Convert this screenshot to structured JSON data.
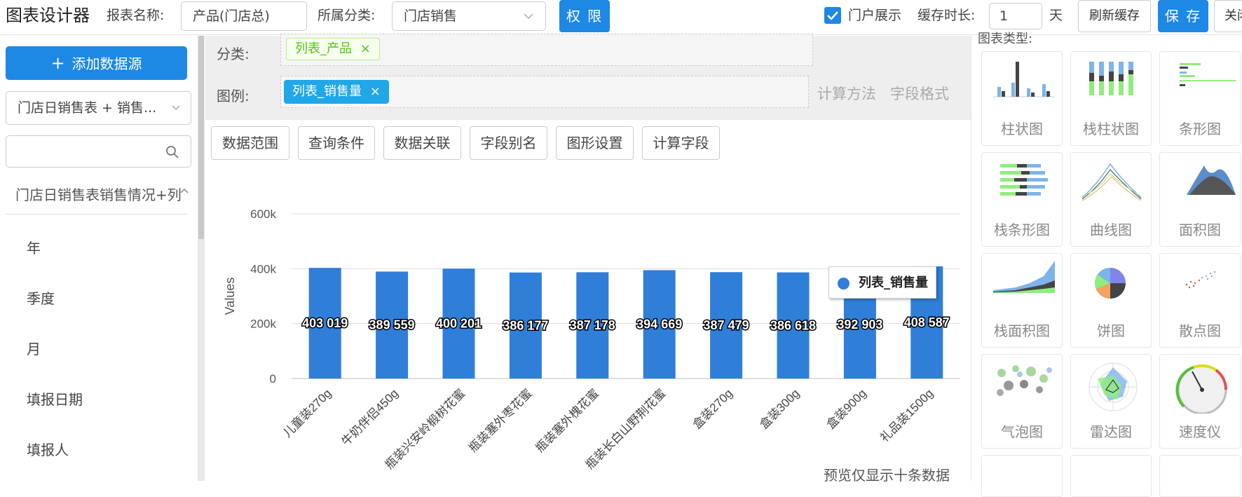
{
  "header": {
    "app_title": "图表设计器",
    "report_name_label": "报表名称:",
    "report_name_value": "产品(门店总)",
    "category_label": "所属分类:",
    "category_value": "门店销售",
    "permission_button": "权 限",
    "portal_display_label": "门户展示",
    "cache_label": "缓存时长:",
    "cache_value": "1",
    "cache_unit": "天",
    "refresh_cache_button": "刷新缓存",
    "save_button": "保 存",
    "close_button": "关闭"
  },
  "sidebar": {
    "add_source_button": "添加数据源",
    "source_select": "门店日销售表 + 销售...",
    "table_name": "门店日销售表销售情况+列",
    "fields": [
      "年",
      "季度",
      "月",
      "填报日期",
      "填报人"
    ]
  },
  "config": {
    "category_label": "分类:",
    "category_tag": "列表_产品",
    "legend_label": "图例:",
    "legend_tag": "列表_销售量",
    "calc_method": "计算方法",
    "field_format": "字段格式",
    "tabs": [
      "数据范围",
      "查询条件",
      "数据关联",
      "字段别名",
      "图形设置",
      "计算字段"
    ]
  },
  "chart_data": {
    "type": "bar",
    "categories": [
      "儿童装270g",
      "牛奶伴侣450g",
      "瓶装兴安岭椴树花蜜",
      "瓶装塞外枣花蜜",
      "瓶装塞外槐花蜜",
      "瓶装长白山野荆花蜜",
      "盒装270g",
      "盒装300g",
      "盒装900g",
      "礼品装1500g"
    ],
    "series": [
      {
        "name": "列表_销售量",
        "values": [
          403019,
          389559,
          400201,
          386177,
          387178,
          394669,
          387479,
          386618,
          392903,
          408587
        ]
      }
    ],
    "data_labels": [
      "403 019",
      "389 559",
      "400 201",
      "386 177",
      "387 178",
      "394 669",
      "387 479",
      "386 618",
      "392 903",
      "408 587"
    ],
    "ylabel": "Values",
    "ylim": [
      0,
      600000
    ],
    "yticks": [
      0,
      200000,
      400000,
      600000
    ],
    "ytick_labels": [
      "0",
      "200k",
      "400k",
      "600k"
    ],
    "grid": true,
    "legend_position": "right",
    "color": "#2f7ed8"
  },
  "preview_note": "预览仅显示十条数据",
  "chart_types": {
    "title": "图表类型:",
    "items": [
      "柱状图",
      "栈柱状图",
      "条形图",
      "栈条形图",
      "曲线图",
      "面积图",
      "栈面积图",
      "饼图",
      "散点图",
      "气泡图",
      "雷达图",
      "速度仪"
    ]
  }
}
